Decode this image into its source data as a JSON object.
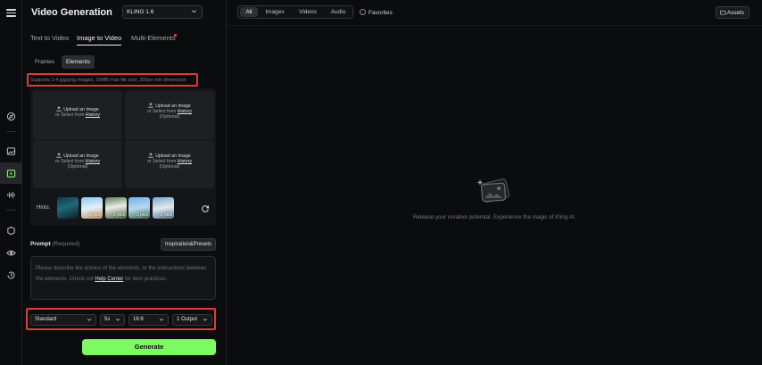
{
  "app": {
    "title": "Video Generation",
    "model": "KLING 1.6"
  },
  "main_tabs": [
    {
      "label": "Text to Video"
    },
    {
      "label": "Image to Video"
    },
    {
      "label": "Multi-Elements"
    }
  ],
  "sub_tabs": [
    {
      "label": "Frames"
    },
    {
      "label": "Elements"
    }
  ],
  "upload": {
    "requirements": "Supports 1-4 jpg/png images, 10MB max file size, 300px min dimension",
    "card_title": "Upload an Image",
    "card_select_prefix": "or Select from",
    "card_history": "History",
    "card_optional": "(Optional)"
  },
  "hints": {
    "label": "Hints:",
    "items": [
      {
        "pics": ""
      },
      {
        "pics": "2 pics"
      },
      {
        "pics": "2 pics"
      },
      {
        "pics": "3 pics"
      },
      {
        "pics": "2 pics"
      }
    ]
  },
  "prompt": {
    "label": "Prompt",
    "required": "(Required)",
    "inspiration_button": "Inspiration&Presets",
    "placeholder_part1": "Please describe the actions of the elements, or the interactions between the elements. Check out",
    "help_center": "Help Center",
    "placeholder_part2": "for best practices."
  },
  "settings": {
    "mode": "Standard",
    "duration": "5s",
    "ratio": "16:9",
    "outputs": "1 Output"
  },
  "generate_label": "Generate",
  "filters": [
    {
      "label": "All"
    },
    {
      "label": "Images"
    },
    {
      "label": "Videos"
    },
    {
      "label": "Audio"
    }
  ],
  "favorites_label": "Favorites",
  "assets_label": "Assets",
  "empty_state": "Release your creative potential. Experience the magic of Kling AI.",
  "colors": {
    "accent": "#7dfa62",
    "highlight": "#e03a3a",
    "background": "#0b0c0e"
  }
}
